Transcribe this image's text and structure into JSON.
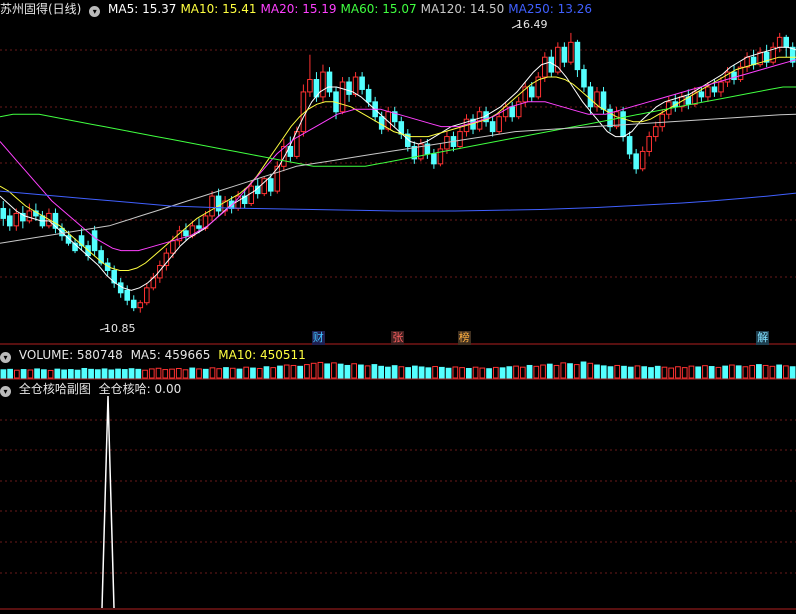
{
  "header": {
    "stock_title": "苏州固得(日线)",
    "ma": [
      {
        "label": "MA5: 15.37",
        "color": "#ffffff"
      },
      {
        "label": "MA10: 15.41",
        "color": "#ffff40"
      },
      {
        "label": "MA20: 15.19",
        "color": "#ff40ff"
      },
      {
        "label": "MA60: 15.07",
        "color": "#40ff40"
      },
      {
        "label": "MA120: 14.50",
        "color": "#c8c8c8"
      },
      {
        "label": "MA250: 13.26",
        "color": "#4060ff"
      }
    ]
  },
  "volume_header": {
    "volume": "VOLUME: 580748",
    "ma5": "MA5: 459665",
    "ma10": "MA10: 450511"
  },
  "indicator_header": {
    "title": "全仓核哈副图",
    "value": "全仓核哈: 0.00"
  },
  "markers": [
    {
      "text": "财",
      "color": "#40c0ff",
      "bg": "#202050",
      "x_index": 47
    },
    {
      "text": "张",
      "color": "#ff6060",
      "bg": "#402020",
      "x_index": 59
    },
    {
      "text": "榜",
      "color": "#ffb040",
      "bg": "#403020",
      "x_index": 69
    },
    {
      "text": "解",
      "color": "#80e0ff",
      "bg": "#204050",
      "x_index": 114
    }
  ],
  "chart_data": {
    "type": "candlestick",
    "price_range": [
      10.5,
      16.75
    ],
    "high_label": "16.49",
    "low_label": "10.85",
    "candles": [
      [
        12.95,
        12.75,
        13.1,
        12.6
      ],
      [
        12.8,
        12.6,
        12.95,
        12.5
      ],
      [
        12.6,
        12.85,
        12.95,
        12.5
      ],
      [
        12.85,
        12.7,
        13.0,
        12.55
      ],
      [
        12.7,
        12.9,
        13.05,
        12.65
      ],
      [
        12.9,
        12.8,
        13.05,
        12.7
      ],
      [
        12.8,
        12.6,
        12.9,
        12.55
      ],
      [
        12.6,
        12.85,
        12.95,
        12.55
      ],
      [
        12.85,
        12.55,
        12.95,
        12.45
      ],
      [
        12.55,
        12.4,
        12.65,
        12.3
      ],
      [
        12.4,
        12.25,
        12.5,
        12.2
      ],
      [
        12.25,
        12.1,
        12.35,
        12.05
      ],
      [
        12.4,
        12.2,
        12.55,
        12.1
      ],
      [
        12.2,
        12.0,
        12.3,
        11.9
      ],
      [
        12.5,
        12.1,
        12.6,
        12.0
      ],
      [
        12.1,
        11.85,
        12.2,
        11.8
      ],
      [
        11.85,
        11.7,
        11.95,
        11.6
      ],
      [
        11.7,
        11.45,
        11.8,
        11.35
      ],
      [
        11.45,
        11.25,
        11.55,
        11.15
      ],
      [
        11.3,
        11.1,
        11.4,
        11.0
      ],
      [
        11.1,
        10.95,
        11.2,
        10.88
      ],
      [
        10.95,
        11.05,
        11.1,
        10.85
      ],
      [
        11.05,
        11.35,
        11.45,
        11.0
      ],
      [
        11.35,
        11.55,
        11.65,
        11.3
      ],
      [
        11.55,
        11.8,
        11.9,
        11.45
      ],
      [
        11.8,
        12.05,
        12.15,
        11.7
      ],
      [
        12.05,
        12.3,
        12.4,
        11.95
      ],
      [
        12.3,
        12.5,
        12.6,
        12.2
      ],
      [
        12.5,
        12.4,
        12.65,
        12.3
      ],
      [
        12.4,
        12.6,
        12.7,
        12.35
      ],
      [
        12.6,
        12.55,
        12.75,
        12.45
      ],
      [
        12.55,
        12.8,
        12.9,
        12.5
      ],
      [
        12.8,
        13.2,
        13.3,
        12.7
      ],
      [
        13.2,
        12.9,
        13.35,
        12.8
      ],
      [
        12.9,
        13.1,
        13.2,
        12.8
      ],
      [
        13.1,
        12.95,
        13.2,
        12.85
      ],
      [
        12.95,
        13.2,
        13.3,
        12.9
      ],
      [
        13.2,
        13.05,
        13.35,
        12.95
      ],
      [
        13.05,
        13.4,
        13.5,
        13.0
      ],
      [
        13.4,
        13.25,
        13.55,
        13.15
      ],
      [
        13.25,
        13.55,
        13.6,
        13.2
      ],
      [
        13.55,
        13.3,
        13.65,
        13.2
      ],
      [
        13.3,
        13.8,
        13.9,
        13.25
      ],
      [
        13.8,
        14.2,
        14.35,
        13.7
      ],
      [
        14.2,
        14.0,
        14.4,
        13.9
      ],
      [
        14.0,
        14.5,
        14.6,
        13.95
      ],
      [
        14.5,
        15.3,
        15.45,
        14.4
      ],
      [
        15.3,
        15.55,
        16.05,
        15.2
      ],
      [
        15.55,
        15.2,
        15.7,
        15.1
      ],
      [
        15.2,
        15.7,
        15.85,
        15.1
      ],
      [
        15.7,
        15.3,
        15.8,
        15.2
      ],
      [
        15.3,
        14.9,
        15.4,
        14.75
      ],
      [
        14.9,
        15.5,
        15.6,
        14.85
      ],
      [
        15.5,
        15.25,
        15.6,
        15.1
      ],
      [
        15.25,
        15.6,
        15.7,
        15.2
      ],
      [
        15.6,
        15.35,
        15.7,
        15.25
      ],
      [
        15.35,
        15.1,
        15.45,
        15.0
      ],
      [
        15.1,
        14.8,
        15.2,
        14.7
      ],
      [
        14.8,
        14.55,
        14.9,
        14.45
      ],
      [
        14.55,
        14.9,
        15.0,
        14.5
      ],
      [
        14.9,
        14.7,
        15.0,
        14.6
      ],
      [
        14.7,
        14.45,
        14.8,
        14.35
      ],
      [
        14.45,
        14.2,
        14.55,
        14.1
      ],
      [
        14.2,
        13.95,
        14.3,
        13.85
      ],
      [
        13.95,
        14.25,
        14.35,
        13.9
      ],
      [
        14.25,
        14.05,
        14.35,
        13.95
      ],
      [
        14.05,
        13.85,
        14.15,
        13.75
      ],
      [
        13.85,
        14.15,
        14.25,
        13.8
      ],
      [
        14.15,
        14.4,
        14.5,
        14.05
      ],
      [
        14.4,
        14.2,
        14.5,
        14.1
      ],
      [
        14.2,
        14.5,
        14.6,
        14.15
      ],
      [
        14.5,
        14.75,
        14.85,
        14.4
      ],
      [
        14.75,
        14.55,
        14.85,
        14.45
      ],
      [
        14.55,
        14.9,
        15.0,
        14.5
      ],
      [
        14.9,
        14.7,
        15.0,
        14.6
      ],
      [
        14.7,
        14.5,
        14.8,
        14.4
      ],
      [
        14.5,
        14.8,
        14.9,
        14.45
      ],
      [
        14.8,
        15.0,
        15.1,
        14.7
      ],
      [
        15.0,
        14.8,
        15.1,
        14.7
      ],
      [
        14.8,
        15.1,
        15.2,
        14.75
      ],
      [
        15.1,
        15.4,
        15.5,
        15.0
      ],
      [
        15.4,
        15.2,
        15.5,
        15.1
      ],
      [
        15.2,
        15.6,
        15.7,
        15.15
      ],
      [
        15.6,
        16.0,
        16.1,
        15.5
      ],
      [
        16.0,
        15.7,
        16.15,
        15.6
      ],
      [
        15.7,
        16.2,
        16.3,
        15.65
      ],
      [
        16.2,
        15.9,
        16.3,
        15.8
      ],
      [
        15.9,
        16.3,
        16.49,
        15.85
      ],
      [
        16.3,
        15.75,
        16.35,
        15.6
      ],
      [
        15.75,
        15.4,
        15.85,
        15.3
      ],
      [
        15.4,
        15.0,
        15.5,
        14.85
      ],
      [
        15.0,
        15.3,
        15.4,
        14.9
      ],
      [
        15.3,
        14.95,
        15.4,
        14.85
      ],
      [
        14.95,
        14.6,
        15.05,
        14.5
      ],
      [
        14.6,
        14.9,
        15.0,
        14.55
      ],
      [
        14.9,
        14.4,
        15.0,
        14.3
      ],
      [
        14.4,
        14.05,
        14.5,
        13.95
      ],
      [
        14.05,
        13.75,
        14.15,
        13.65
      ],
      [
        13.75,
        14.1,
        14.2,
        13.7
      ],
      [
        14.1,
        14.4,
        14.5,
        14.0
      ],
      [
        14.4,
        14.6,
        14.7,
        14.3
      ],
      [
        14.6,
        14.85,
        14.95,
        14.5
      ],
      [
        14.85,
        15.1,
        15.2,
        14.75
      ],
      [
        15.1,
        15.0,
        15.25,
        14.9
      ],
      [
        15.0,
        15.2,
        15.3,
        14.9
      ],
      [
        15.2,
        15.05,
        15.35,
        14.95
      ],
      [
        15.05,
        15.3,
        15.4,
        15.0
      ],
      [
        15.3,
        15.2,
        15.4,
        15.1
      ],
      [
        15.2,
        15.4,
        15.5,
        15.1
      ],
      [
        15.4,
        15.3,
        15.55,
        15.2
      ],
      [
        15.3,
        15.5,
        15.6,
        15.2
      ],
      [
        15.5,
        15.7,
        15.8,
        15.4
      ],
      [
        15.7,
        15.55,
        15.85,
        15.45
      ],
      [
        15.55,
        15.8,
        15.9,
        15.5
      ],
      [
        15.8,
        16.0,
        16.1,
        15.7
      ],
      [
        16.0,
        15.85,
        16.15,
        15.75
      ],
      [
        15.85,
        16.1,
        16.2,
        15.8
      ],
      [
        16.1,
        15.9,
        16.25,
        15.8
      ],
      [
        15.9,
        16.2,
        16.3,
        15.85
      ],
      [
        16.2,
        16.4,
        16.49,
        16.1
      ],
      [
        16.4,
        16.2,
        16.45,
        16.0
      ],
      [
        16.2,
        15.9,
        16.3,
        15.8
      ]
    ],
    "moving_averages": [
      {
        "name": "MA5",
        "color": "#ffffff",
        "values": [
          13.2,
          13.05,
          12.9,
          12.8,
          12.75,
          12.7,
          12.7,
          12.55,
          12.4,
          12.25,
          12.1,
          11.95,
          11.8,
          11.6,
          11.45,
          11.35,
          11.3,
          11.35,
          11.45,
          11.6,
          11.8,
          12.0,
          12.2,
          12.35,
          12.45,
          12.55,
          12.7,
          12.85,
          13.0,
          13.1,
          13.2,
          13.3,
          13.45,
          13.6,
          13.8,
          14.1,
          14.45,
          14.8,
          15.1,
          15.3,
          15.4,
          15.4,
          15.35,
          15.3,
          15.2,
          15.05,
          14.9,
          14.75,
          14.6,
          14.45,
          14.3,
          14.25,
          14.3,
          14.4,
          14.5,
          14.6,
          14.65,
          14.7,
          14.75,
          14.8,
          14.9,
          15.0,
          15.15,
          15.3,
          15.5,
          15.7,
          15.85,
          15.9,
          15.8,
          15.6,
          15.35,
          15.1,
          14.9,
          14.7,
          14.5,
          14.4,
          14.4,
          14.5,
          14.7,
          14.85,
          15.0,
          15.1,
          15.15,
          15.2,
          15.25,
          15.35,
          15.45,
          15.55,
          15.65,
          15.8,
          15.9,
          16.0,
          16.05,
          16.1,
          16.15,
          16.2,
          16.2,
          16.15
        ]
      },
      {
        "name": "MA10",
        "color": "#ffff40",
        "values": [
          13.4,
          13.3,
          13.15,
          13.0,
          12.9,
          12.8,
          12.7,
          12.6,
          12.45,
          12.3,
          12.15,
          12.0,
          11.85,
          11.75,
          11.7,
          11.7,
          11.75,
          11.85,
          12.0,
          12.15,
          12.3,
          12.45,
          12.6,
          12.75,
          12.85,
          12.95,
          13.05,
          13.15,
          13.25,
          13.4,
          13.6,
          13.85,
          14.1,
          14.35,
          14.6,
          14.8,
          14.95,
          15.05,
          15.1,
          15.1,
          15.05,
          15.0,
          14.9,
          14.8,
          14.7,
          14.6,
          14.5,
          14.45,
          14.4,
          14.4,
          14.4,
          14.45,
          14.5,
          14.55,
          14.6,
          14.65,
          14.7,
          14.75,
          14.85,
          15.0,
          15.15,
          15.3,
          15.45,
          15.55,
          15.6,
          15.6,
          15.55,
          15.45,
          15.3,
          15.15,
          15.0,
          14.9,
          14.8,
          14.75,
          14.7,
          14.7,
          14.75,
          14.85,
          14.95,
          15.05,
          15.15,
          15.25,
          15.35,
          15.45,
          15.55,
          15.65,
          15.75,
          15.8,
          15.85,
          15.9,
          15.95,
          16.0,
          16.0,
          16.0
        ]
      },
      {
        "name": "MA20",
        "color": "#ff40ff",
        "values": [
          14.3,
          14.1,
          13.9,
          13.7,
          13.5,
          13.3,
          13.1,
          12.95,
          12.8,
          12.65,
          12.5,
          12.35,
          12.25,
          12.15,
          12.1,
          12.1,
          12.1,
          12.15,
          12.2,
          12.25,
          12.3,
          12.35,
          12.4,
          12.5,
          12.6,
          12.75,
          12.9,
          13.05,
          13.25,
          13.45,
          13.65,
          13.85,
          14.05,
          14.2,
          14.35,
          14.45,
          14.55,
          14.65,
          14.75,
          14.85,
          14.9,
          14.95,
          14.95,
          14.95,
          14.95,
          14.9,
          14.85,
          14.8,
          14.75,
          14.7,
          14.65,
          14.6,
          14.6,
          14.6,
          14.65,
          14.7,
          14.75,
          14.8,
          14.9,
          15.0,
          15.05,
          15.1,
          15.1,
          15.1,
          15.05,
          15.0,
          14.95,
          14.9,
          14.85,
          14.85,
          14.85,
          14.9,
          14.95,
          15.0,
          15.05,
          15.1,
          15.15,
          15.2,
          15.25,
          15.3,
          15.35,
          15.4,
          15.45,
          15.5,
          15.55,
          15.6,
          15.65,
          15.7,
          15.75,
          15.8,
          15.85,
          15.9,
          15.95
        ]
      },
      {
        "name": "MA60",
        "color": "#40ff40",
        "values": [
          14.8,
          14.85,
          14.85,
          14.85,
          14.8,
          14.75,
          14.7,
          14.65,
          14.6,
          14.55,
          14.5,
          14.45,
          14.4,
          14.35,
          14.3,
          14.25,
          14.2,
          14.15,
          14.1,
          14.05,
          14.0,
          13.95,
          13.9,
          13.85,
          13.8,
          13.8,
          13.8,
          13.8,
          13.8,
          13.85,
          13.9,
          13.95,
          14.0,
          14.05,
          14.1,
          14.15,
          14.2,
          14.25,
          14.3,
          14.35,
          14.4,
          14.45,
          14.5,
          14.55,
          14.6,
          14.65,
          14.7,
          14.75,
          14.8,
          14.85,
          14.9,
          14.95,
          15.0,
          15.05,
          15.1,
          15.15,
          15.2,
          15.25,
          15.3,
          15.35,
          15.4,
          15.4
        ]
      },
      {
        "name": "MA120",
        "color": "#c8c8c8",
        "values": [
          12.25,
          12.3,
          12.35,
          12.4,
          12.45,
          12.5,
          12.55,
          12.6,
          12.7,
          12.8,
          12.9,
          13.0,
          13.1,
          13.2,
          13.3,
          13.4,
          13.5,
          13.6,
          13.7,
          13.8,
          13.85,
          13.9,
          13.95,
          14.0,
          14.05,
          14.1,
          14.15,
          14.2,
          14.25,
          14.3,
          14.35,
          14.4,
          14.45,
          14.5,
          14.52,
          14.54,
          14.56,
          14.58,
          14.6,
          14.62,
          14.64,
          14.66,
          14.68,
          14.7,
          14.72,
          14.74,
          14.76,
          14.78,
          14.8,
          14.82,
          14.84,
          14.85
        ]
      },
      {
        "name": "MA250",
        "color": "#4060ff",
        "values": [
          13.3,
          13.25,
          13.2,
          13.15,
          13.1,
          13.05,
          13.0,
          12.98,
          12.96,
          12.95,
          12.94,
          12.93,
          12.92,
          12.91,
          12.9,
          12.9,
          12.9,
          12.91,
          12.92,
          12.93,
          12.95,
          12.97,
          13.0,
          13.03,
          13.06,
          13.1,
          13.15,
          13.2,
          13.26
        ]
      }
    ],
    "volume": [
      38,
      40,
      36,
      39,
      37,
      42,
      38,
      35,
      41,
      37,
      39,
      36,
      44,
      40,
      38,
      42,
      37,
      41,
      39,
      43,
      40,
      36,
      42,
      45,
      39,
      41,
      44,
      38,
      46,
      42,
      40,
      47,
      43,
      48,
      45,
      41,
      50,
      46,
      44,
      52,
      48,
      55,
      60,
      58,
      54,
      62,
      68,
      72,
      65,
      70,
      64,
      58,
      66,
      60,
      56,
      62,
      54,
      50,
      57,
      52,
      48,
      55,
      51,
      47,
      53,
      49,
      45,
      51,
      48,
      44,
      50,
      46,
      43,
      49,
      47,
      52,
      55,
      50,
      58,
      54,
      60,
      64,
      58,
      70,
      66,
      62,
      74,
      68,
      60,
      56,
      52,
      58,
      54,
      50,
      56,
      52,
      48,
      54,
      50,
      46,
      52,
      48,
      55,
      51,
      57,
      53,
      49,
      55,
      60,
      56,
      52,
      58,
      62,
      58,
      54,
      60,
      56,
      52
    ],
    "indicator": {
      "range": [
        0,
        1
      ],
      "spike_index": 15,
      "spike_value": 1.0
    }
  }
}
